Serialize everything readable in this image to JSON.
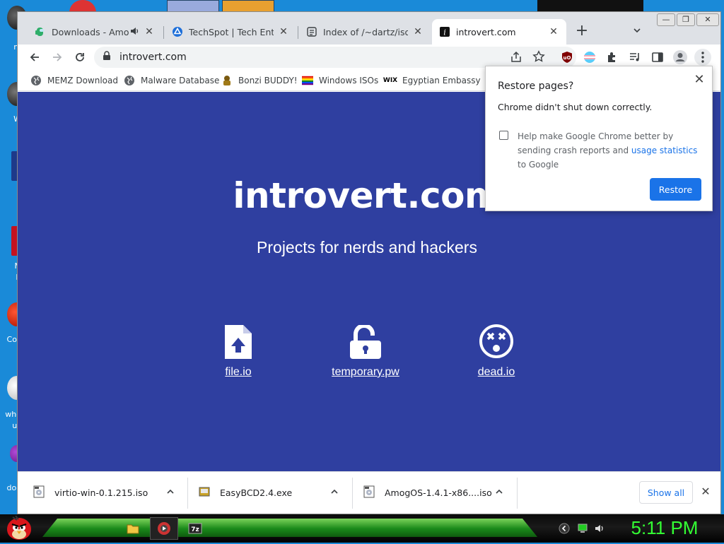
{
  "browser": {
    "tabs": [
      {
        "title": "Downloads - Amog",
        "favicon": "amogus-icon",
        "audio": true
      },
      {
        "title": "TechSpot | Tech Enthusi",
        "favicon": "techspot-icon"
      },
      {
        "title": "Index of /~dartz/isos/",
        "favicon": "folder-index-icon"
      },
      {
        "title": "introvert.com",
        "favicon": "info-icon",
        "active": true
      }
    ],
    "omnibox_url": "introvert.com",
    "bookmarks": [
      {
        "label": "MEMZ Download",
        "icon": "globe-icon"
      },
      {
        "label": "Malware Database",
        "icon": "globe-icon"
      },
      {
        "label": "Bonzi BUDDY!",
        "icon": "bonzi-icon"
      },
      {
        "label": "Windows ISOs",
        "icon": "rainbow-flag-icon"
      },
      {
        "label": "Egyptian Embassy",
        "icon": "wix-icon"
      }
    ],
    "accent_color": "#1a73e8",
    "page_background": "#2f3fa0"
  },
  "page": {
    "site_title": "introvert.com",
    "tagline": "Projects for nerds and hackers",
    "features": [
      {
        "label": "file.io",
        "icon": "file-upload-icon"
      },
      {
        "label": "temporary.pw",
        "icon": "unlock-icon"
      },
      {
        "label": "dead.io",
        "icon": "dizzy-face-icon"
      }
    ]
  },
  "restore_bubble": {
    "title": "Restore pages?",
    "message": "Chrome didn't shut down correctly.",
    "option_text_1": "Help make Google Chrome better by sending crash reports and",
    "option_link": "usage statistics",
    "option_text_2": "to Google",
    "checked": false,
    "button_label": "Restore"
  },
  "downloads": {
    "items": [
      {
        "name": "virtio-win-0.1.215.iso",
        "icon": "iso-file-icon"
      },
      {
        "name": "EasyBCD2.4.exe",
        "icon": "exe-file-icon"
      },
      {
        "name": "AmogOS-1.4.1-x86....iso",
        "icon": "iso-file-icon"
      }
    ],
    "show_all_label": "Show all"
  },
  "taskbar": {
    "clock": "5:11 PM",
    "pinned": [
      "folder-icon",
      "media-app-icon",
      "7zip-icon"
    ],
    "tray": [
      "back-icon",
      "network-icon",
      "volume-icon"
    ]
  },
  "desktop": {
    "icon_labels": [
      "m",
      "W",
      "F",
      "M",
      "R",
      "Coc",
      "who",
      "us",
      "doe"
    ]
  }
}
